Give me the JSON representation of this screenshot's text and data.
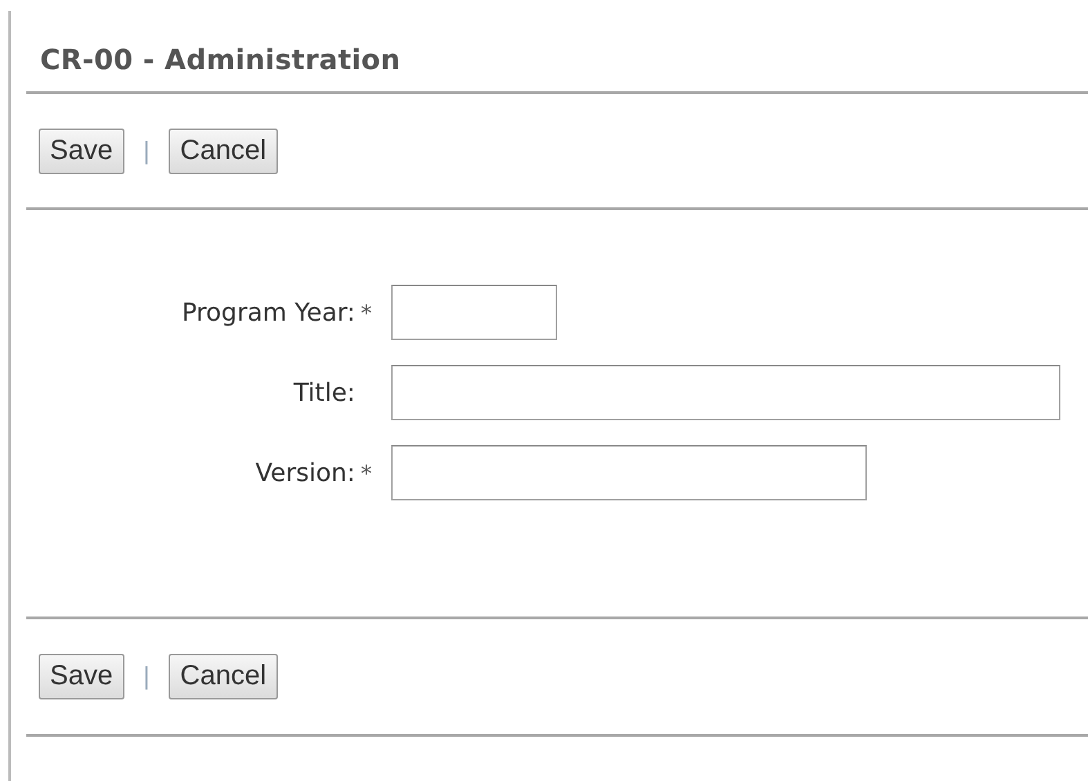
{
  "title": "CR-00 - Administration",
  "top_actions": {
    "buttons": [
      "Save",
      "Cancel"
    ],
    "separator": "|"
  },
  "fields": [
    {
      "label": "Program Year:",
      "mark": "*",
      "kind": "short"
    },
    {
      "label": "Title:",
      "kind": "long"
    },
    {
      "label": "Version:",
      "mark": "*",
      "kind": "medium"
    }
  ],
  "bottom_actions": {
    "buttons": [
      "Save",
      "Cancel"
    ],
    "separator": "|"
  }
}
